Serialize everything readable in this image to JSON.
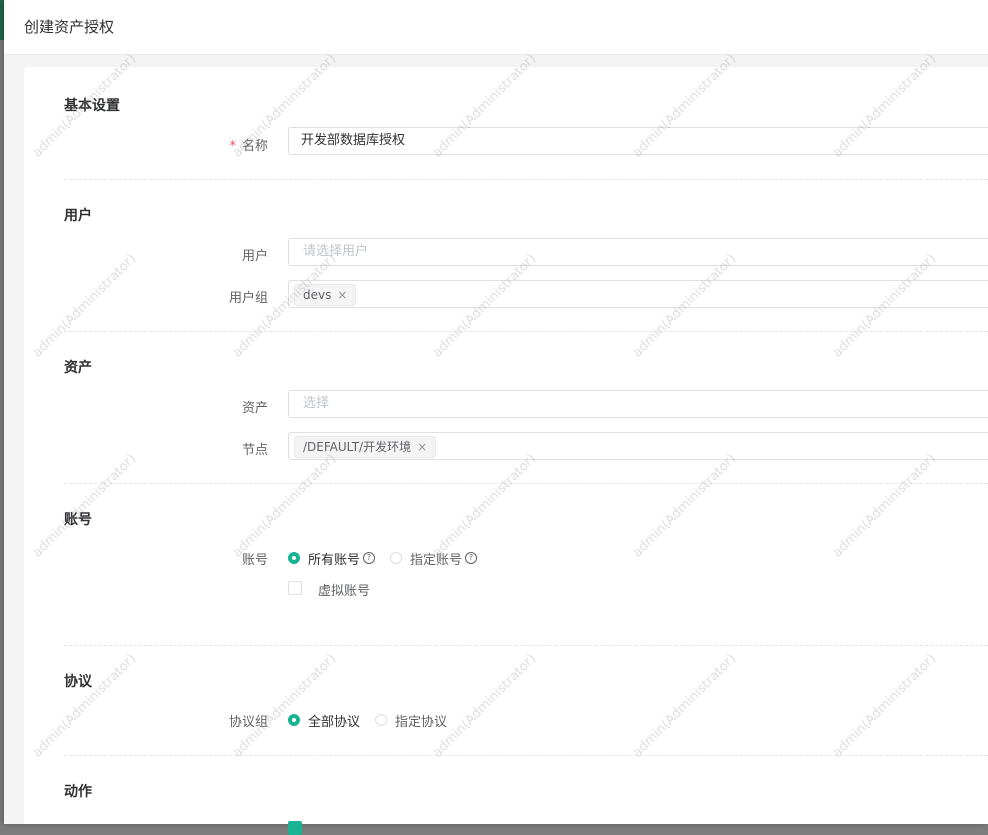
{
  "dialog": {
    "title": "创建资产授权"
  },
  "sections": {
    "basic": {
      "title": "基本设置",
      "name_label": "名称",
      "name_required_mark": "*",
      "name_value": "开发部数据库授权"
    },
    "users": {
      "title": "用户",
      "user_label": "用户",
      "user_placeholder": "请选择用户",
      "group_label": "用户组",
      "group_tags": [
        "devs"
      ]
    },
    "assets": {
      "title": "资产",
      "asset_label": "资产",
      "asset_placeholder": "选择",
      "node_label": "节点",
      "node_tags": [
        "/DEFAULT/开发环境"
      ]
    },
    "accounts": {
      "title": "账号",
      "label": "账号",
      "options": [
        {
          "label": "所有账号",
          "selected": true,
          "help_icon": "question-circle-icon"
        },
        {
          "label": "指定账号",
          "selected": false,
          "help_icon": "question-circle-icon"
        }
      ],
      "virtual_label": "虚拟账号",
      "virtual_checked": false
    },
    "protocols": {
      "title": "协议",
      "label": "协议组",
      "options": [
        {
          "label": "全部协议",
          "selected": true
        },
        {
          "label": "指定协议",
          "selected": false
        }
      ]
    },
    "actions": {
      "title": "动作"
    }
  },
  "watermark_text": "admin(Administrator)",
  "colors": {
    "accent": "#1ab394",
    "required": "#ed5565",
    "header_strip": "#1f6b4b"
  }
}
